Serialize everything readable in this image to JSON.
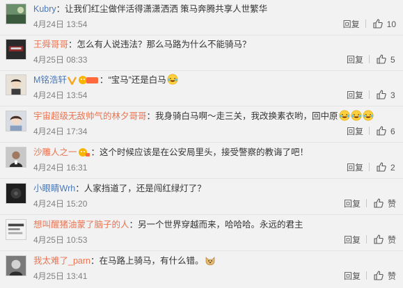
{
  "comments": [
    {
      "user": "Kubry",
      "text": "让我们红尘做伴活得潇潇洒洒 策马奔腾共享人世繁华",
      "time": "4月24日 13:54",
      "reply": "回复",
      "likes": "10",
      "emoji_after": [],
      "badges": []
    },
    {
      "user": "王舜哥哥",
      "text": "怎么有人说违法？那么马路为什么不能骑马？",
      "time": "4月25日 08:33",
      "reply": "回复",
      "likes": "5",
      "emoji_after": [],
      "badges": []
    },
    {
      "user": "M铭浩轩",
      "text": "“宝马”还是白马",
      "time": "4月24日 13:54",
      "reply": "回复",
      "likes": "3",
      "emoji_after": [
        "laugh-cry-emoji"
      ],
      "badges": [
        "verified-v-icon",
        "fan-badge-icon"
      ]
    },
    {
      "user": "宇宙超级无敌帅气的林夕哥哥",
      "text": "我身骑白马啊～走三关，我改换素衣哟，回中原",
      "time": "4月24日 17:34",
      "reply": "回复",
      "likes": "6",
      "emoji_after": [
        "laugh-cry-emoji",
        "laugh-cry-emoji",
        "laugh-cry-emoji"
      ],
      "badges": []
    },
    {
      "user": "沙雕人之一",
      "text": "这个时候应该是在公安局里头，接受警察的教诲了吧！",
      "time": "4月24日 16:31",
      "reply": "回复",
      "likes": "2",
      "emoji_after": [],
      "badges": [
        "fan-badge-icon"
      ]
    },
    {
      "user": "小眼睛Wrh",
      "text": "人家挡道了，还是闯红绿灯了？",
      "time": "4月24日 15:20",
      "reply": "回复",
      "likes": "赞",
      "emoji_after": [],
      "badges": []
    },
    {
      "user": "想叫醒猪油蒙了脑子的人",
      "text": "另一个世界穿越而来，哈哈哈。永远的君主",
      "time": "4月25日 10:53",
      "reply": "回复",
      "likes": "赞",
      "emoji_after": [],
      "badges": []
    },
    {
      "user": "我太难了_parn",
      "text": "在马路上骑马，有什么错。",
      "time": "4月25日 13:41",
      "reply": "回复",
      "likes": "赞",
      "emoji_after": [
        "doge-emoji"
      ],
      "badges": []
    }
  ],
  "colors": {
    "username": "#eb7350",
    "username_alt": "#4b78b4",
    "time": "#808080",
    "background": "#f2f2f2"
  }
}
